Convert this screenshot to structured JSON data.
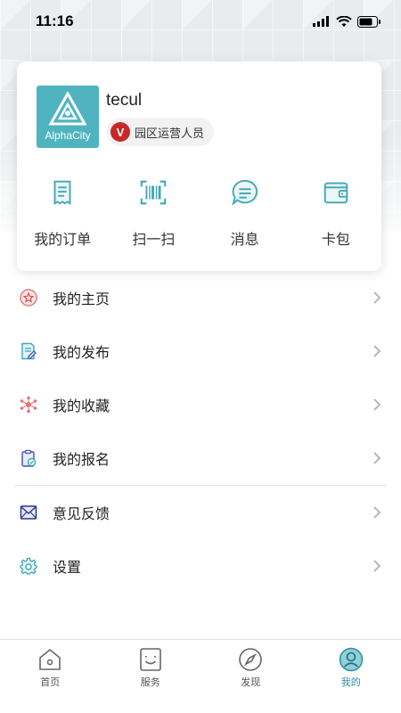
{
  "status_bar": {
    "time": "11:16"
  },
  "profile": {
    "avatar_text": "AlphaCity",
    "username": "tecul",
    "role_badge_letter": "V",
    "role": "园区运营人员"
  },
  "quick_actions": [
    {
      "label": "我的订单",
      "icon": "receipt-icon"
    },
    {
      "label": "扫一扫",
      "icon": "scan-icon"
    },
    {
      "label": "消息",
      "icon": "message-icon"
    },
    {
      "label": "卡包",
      "icon": "wallet-icon"
    }
  ],
  "menu": {
    "homepage": "我的主页",
    "posts": "我的发布",
    "favorites": "我的收藏",
    "registrations": "我的报名",
    "feedback": "意见反馈",
    "settings": "设置"
  },
  "tabbar": {
    "home": "首页",
    "services": "服务",
    "discover": "发现",
    "mine": "我的",
    "active": "mine"
  },
  "colors": {
    "accent": "#4fb4bf",
    "active_tab": "#2f8fa0",
    "badge_red": "#c62828"
  }
}
